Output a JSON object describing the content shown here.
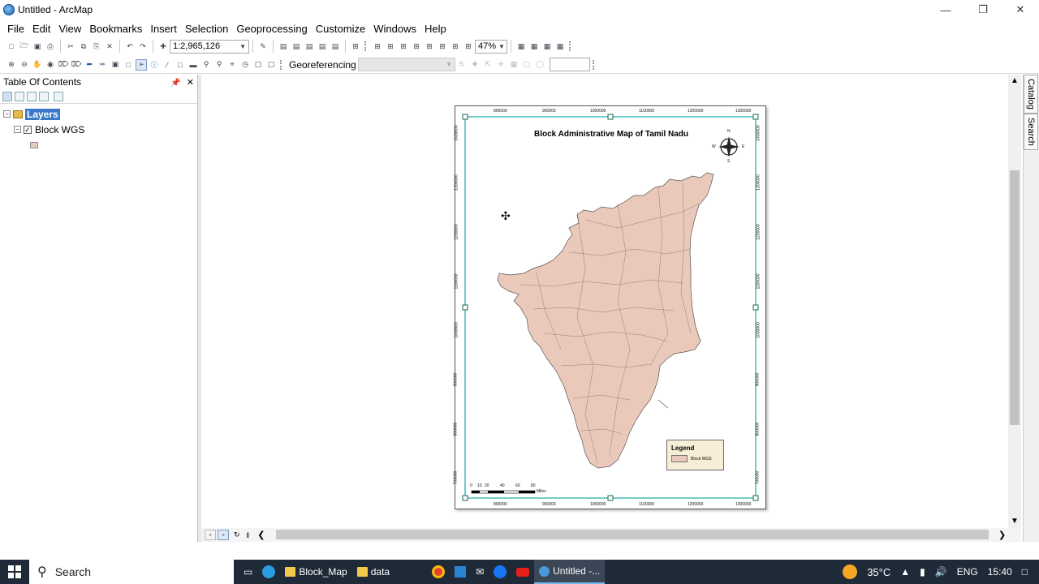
{
  "window": {
    "title": "Untitled - ArcMap",
    "controls": [
      "minimize",
      "restore",
      "close"
    ]
  },
  "menu": [
    "File",
    "Edit",
    "View",
    "Bookmarks",
    "Insert",
    "Selection",
    "Geoprocessing",
    "Customize",
    "Windows",
    "Help"
  ],
  "toolbar": {
    "scale_value": "1:2,965,126",
    "zoom_value": "47%",
    "georeferencing_label": "Georeferencing"
  },
  "toc": {
    "title": "Table Of Contents",
    "layers_label": "Layers",
    "layer_name": "Block WGS",
    "layer_checked": true
  },
  "side_tabs": [
    "Catalog",
    "Search"
  ],
  "map": {
    "title": "Block Administrative Map of Tamil Nadu",
    "fill_color": "#ebc9ba",
    "top_ticks": [
      "800000",
      "900000",
      "1000000",
      "1100000",
      "1200000",
      "1300000"
    ],
    "left_ticks": [
      "1400000",
      "1300000",
      "1200000",
      "1100000",
      "1000000",
      "900000",
      "800000",
      "700000"
    ],
    "north_arrow": {
      "N": "N",
      "S": "S",
      "E": "E",
      "W": "W"
    },
    "scalebar_ticks": [
      "0",
      "10",
      "20",
      "40",
      "60",
      "80"
    ],
    "scalebar_unit": "Miles",
    "legend": {
      "title": "Legend",
      "item": "Block WGS"
    }
  },
  "taskbar": {
    "search_label": "Search",
    "apps": [
      "Block_Map",
      "data",
      "Untitled -..."
    ],
    "temperature": "35°C",
    "language": "ENG",
    "time": "15:40"
  }
}
